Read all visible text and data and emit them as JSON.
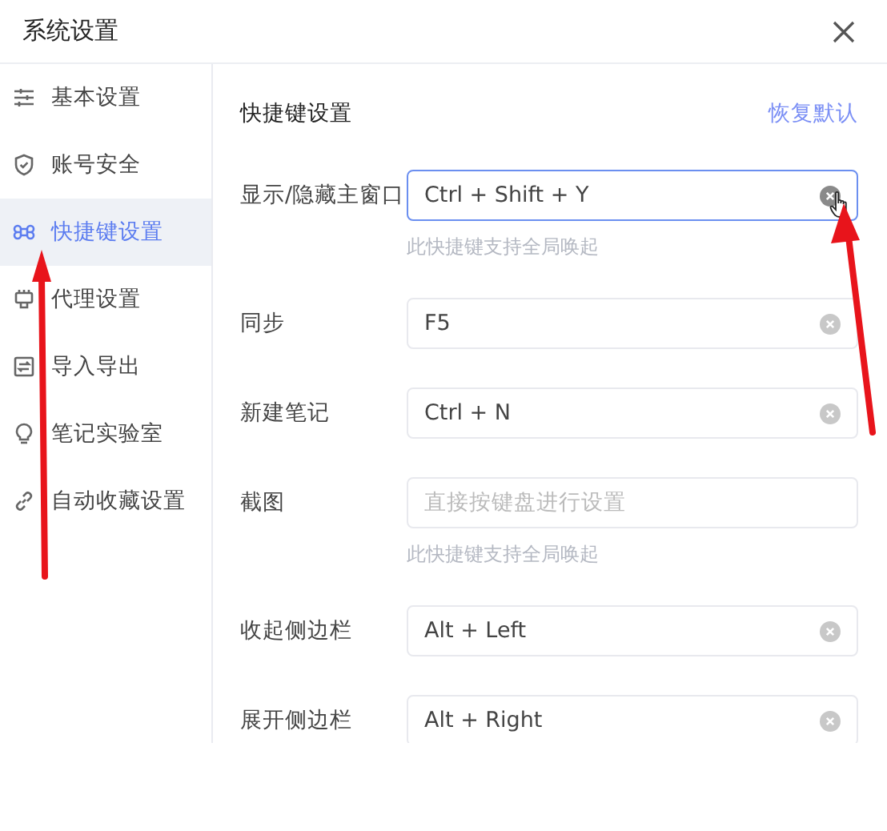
{
  "window": {
    "title": "系统设置"
  },
  "sidebar": {
    "items": [
      {
        "label": "基本设置",
        "selected": false
      },
      {
        "label": "账号安全",
        "selected": false
      },
      {
        "label": "快捷键设置",
        "selected": true
      },
      {
        "label": "代理设置",
        "selected": false
      },
      {
        "label": "导入导出",
        "selected": false
      },
      {
        "label": "笔记实验室",
        "selected": false
      },
      {
        "label": "自动收藏设置",
        "selected": false
      }
    ]
  },
  "content": {
    "title": "快捷键设置",
    "reset_link": "恢复默认",
    "shortcuts": [
      {
        "label": "显示/隐藏主窗口",
        "value": "Ctrl + Shift + Y",
        "focused": true,
        "clear_button": true,
        "hint": "此快捷键支持全局唤起"
      },
      {
        "label": "同步",
        "value": "F5",
        "focused": false,
        "clear_button": true
      },
      {
        "label": "新建笔记",
        "value": "Ctrl + N",
        "focused": false,
        "clear_button": true
      },
      {
        "label": "截图",
        "placeholder": "直接按键盘进行设置",
        "focused": false,
        "clear_button": false,
        "hint": "此快捷键支持全局唤起"
      },
      {
        "label": "收起侧边栏",
        "value": "Alt + Left",
        "focused": false,
        "clear_button": true
      },
      {
        "label": "展开侧边栏",
        "value": "Alt + Right",
        "focused": false,
        "clear_button": true
      }
    ]
  }
}
